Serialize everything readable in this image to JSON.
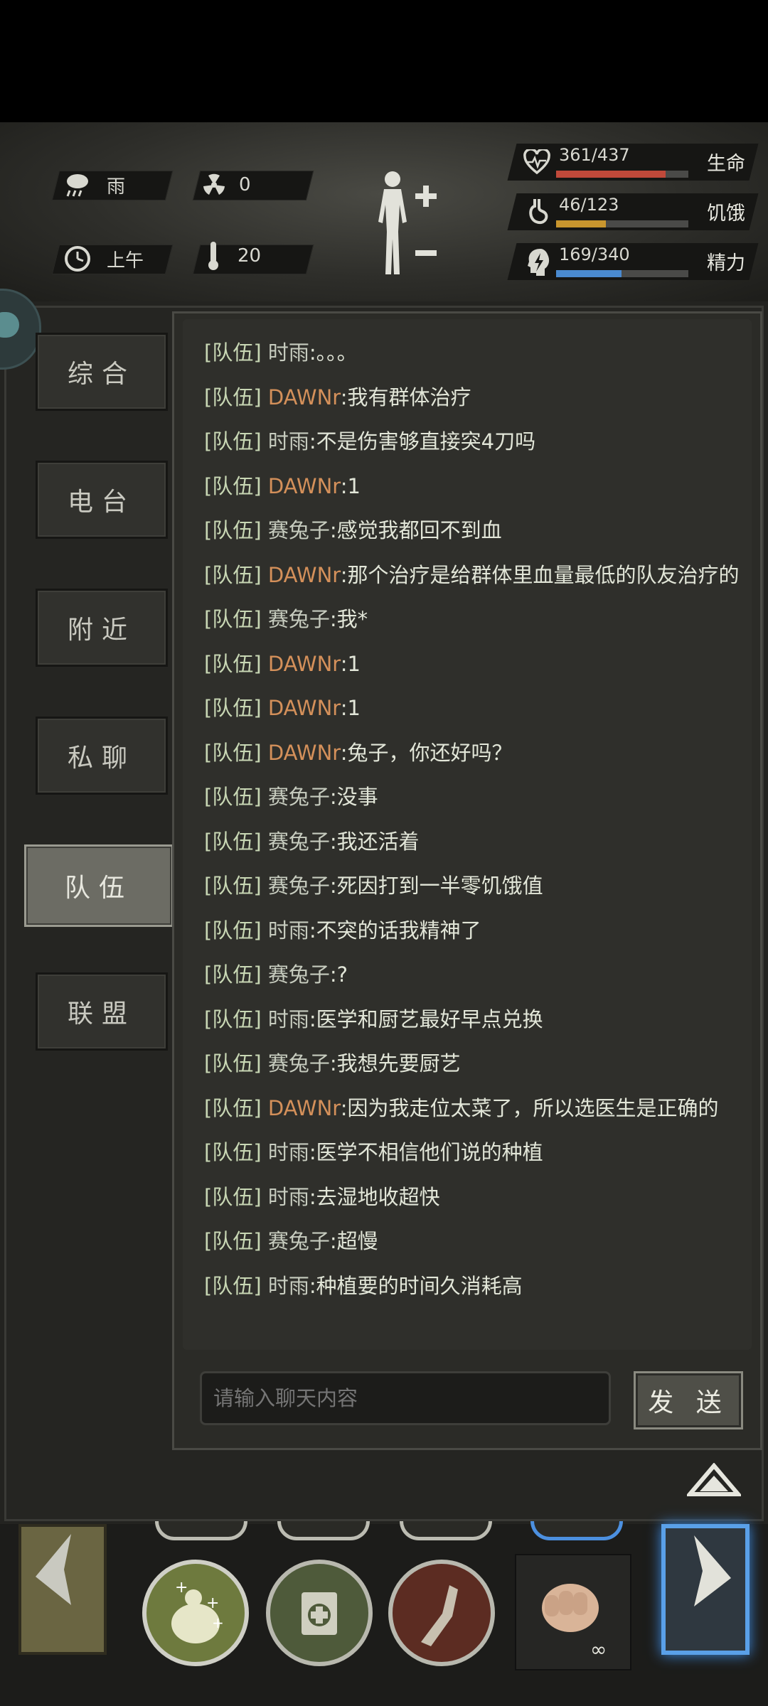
{
  "hud": {
    "weather": "雨",
    "radiation": "0",
    "time_of_day": "上午",
    "temperature": "20",
    "stats": [
      {
        "label": "生命",
        "value": "361/437",
        "fraction": 0.826,
        "color": "#c0493a",
        "icon": "heart-icon"
      },
      {
        "label": "饥饿",
        "value": "46/123",
        "fraction": 0.374,
        "color": "#c9962e",
        "icon": "stomach-icon"
      },
      {
        "label": "精力",
        "value": "169/340",
        "fraction": 0.497,
        "color": "#4a8ad0",
        "icon": "brain-bolt-icon"
      }
    ]
  },
  "tabs": [
    {
      "label": "综合",
      "active": false
    },
    {
      "label": "电台",
      "active": false
    },
    {
      "label": "附近",
      "active": false
    },
    {
      "label": "私聊",
      "active": false
    },
    {
      "label": "队伍",
      "active": true
    },
    {
      "label": "联盟",
      "active": false
    }
  ],
  "chat": {
    "channel": "[队伍]",
    "messages": [
      {
        "sender": "时雨",
        "text": ":。。。",
        "dawn": false
      },
      {
        "sender": "DAWNr",
        "text": ":我有群体治疗",
        "dawn": true
      },
      {
        "sender": "时雨",
        "text": ":不是伤害够直接突4刀吗",
        "dawn": false
      },
      {
        "sender": "DAWNr",
        "text": ":1",
        "dawn": true
      },
      {
        "sender": "赛兔子",
        "text": ":感觉我都回不到血",
        "dawn": false
      },
      {
        "sender": "DAWNr",
        "text": ":那个治疗是给群体里血量最低的队友治疗的",
        "dawn": true
      },
      {
        "sender": "赛兔子",
        "text": ":我*",
        "dawn": false
      },
      {
        "sender": "DAWNr",
        "text": ":1",
        "dawn": true
      },
      {
        "sender": "DAWNr",
        "text": ":1",
        "dawn": true
      },
      {
        "sender": "DAWNr",
        "text": ":兔子，你还好吗？",
        "dawn": true
      },
      {
        "sender": "赛兔子",
        "text": ":没事",
        "dawn": false
      },
      {
        "sender": "赛兔子",
        "text": ":我还活着",
        "dawn": false
      },
      {
        "sender": "赛兔子",
        "text": ":死因打到一半零饥饿值",
        "dawn": false
      },
      {
        "sender": "时雨",
        "text": ":不突的话我精神了",
        "dawn": false
      },
      {
        "sender": "赛兔子",
        "text": ":?",
        "dawn": false
      },
      {
        "sender": "时雨",
        "text": ":医学和厨艺最好早点兑换",
        "dawn": false
      },
      {
        "sender": "赛兔子",
        "text": ":我想先要厨艺",
        "dawn": false
      },
      {
        "sender": "DAWNr",
        "text": ":因为我走位太菜了，所以选医生是正确的",
        "dawn": true
      },
      {
        "sender": "时雨",
        "text": ":医学不相信他们说的种植",
        "dawn": false
      },
      {
        "sender": "时雨",
        "text": ":去湿地收超快",
        "dawn": false
      },
      {
        "sender": "赛兔子",
        "text": ":超慢",
        "dawn": false
      },
      {
        "sender": "时雨",
        "text": ":种植要的时间久消耗高",
        "dawn": false
      }
    ],
    "input_placeholder": "请输入聊天内容",
    "send_label": "发 送"
  },
  "skills": {
    "fist_count": "∞"
  }
}
